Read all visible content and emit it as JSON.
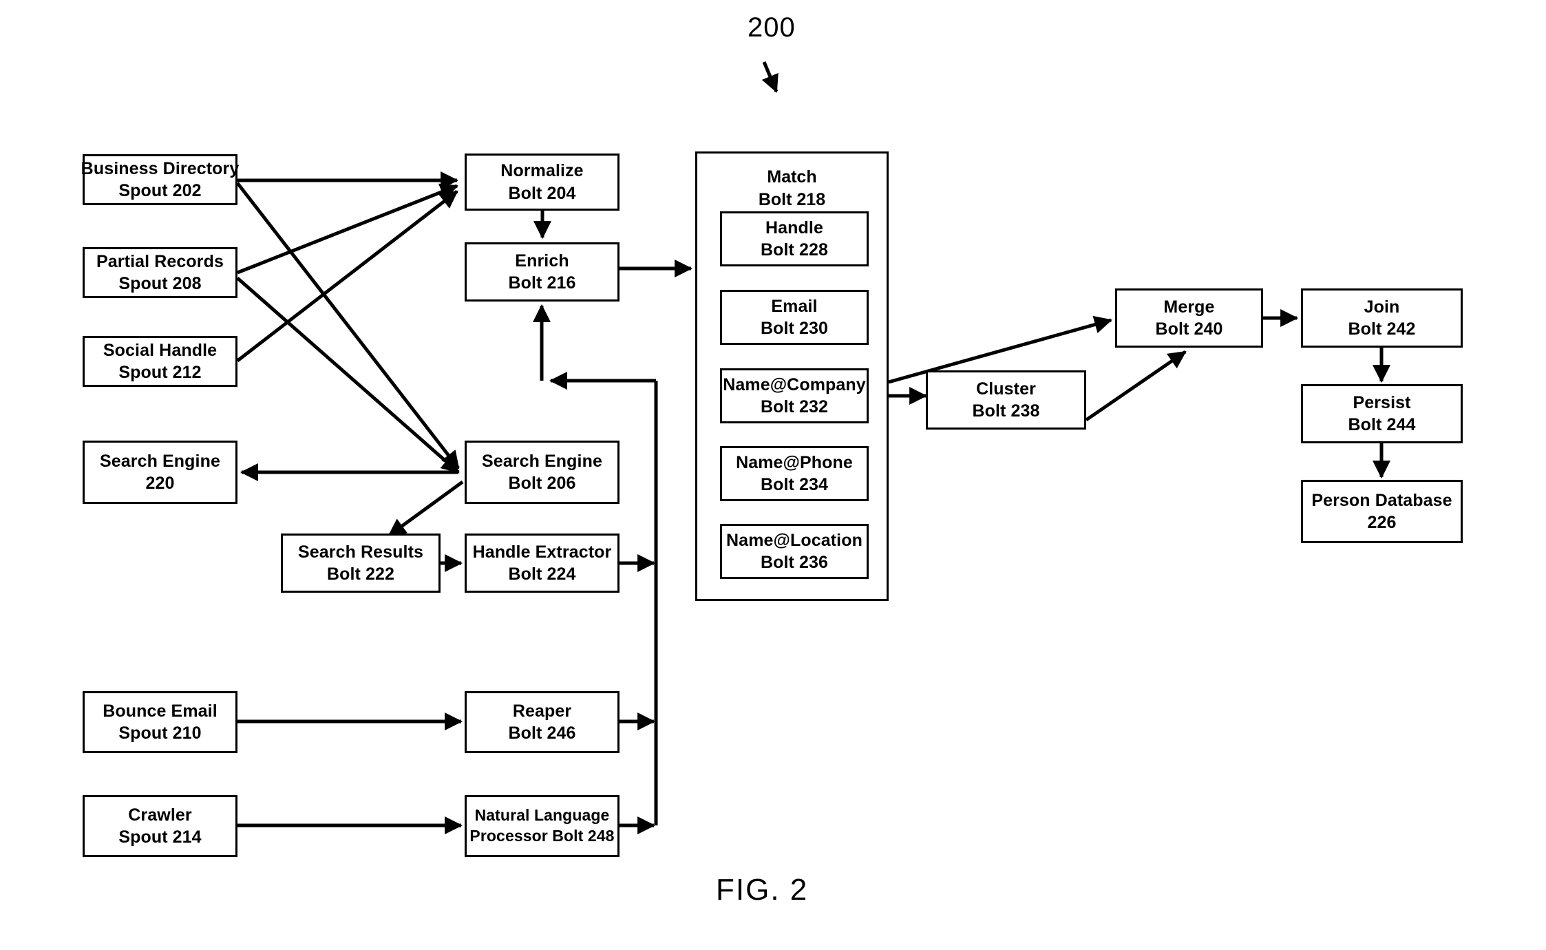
{
  "figure": {
    "reference_numeral": "200",
    "caption": "FIG. 2",
    "line_color": "#000000",
    "background_color": "#ffffff"
  },
  "nodes": {
    "business_directory_spout": {
      "line1": "Business Directory",
      "line2": "Spout 202"
    },
    "partial_records_spout": {
      "line1": "Partial Records",
      "line2": "Spout 208"
    },
    "social_handle_spout": {
      "line1": "Social Handle",
      "line2": "Spout 212"
    },
    "search_engine_external": {
      "line1": "Search Engine",
      "line2": "220"
    },
    "bounce_email_spout": {
      "line1": "Bounce Email",
      "line2": "Spout 210"
    },
    "crawler_spout": {
      "line1": "Crawler",
      "line2": "Spout 214"
    },
    "normalize_bolt": {
      "line1": "Normalize",
      "line2": "Bolt 204"
    },
    "enrich_bolt": {
      "line1": "Enrich",
      "line2": "Bolt 216"
    },
    "search_engine_bolt": {
      "line1": "Search Engine",
      "line2": "Bolt 206"
    },
    "search_results_bolt": {
      "line1": "Search Results",
      "line2": "Bolt 222"
    },
    "handle_extractor_bolt": {
      "line1": "Handle Extractor",
      "line2": "Bolt 224"
    },
    "reaper_bolt": {
      "line1": "Reaper",
      "line2": "Bolt 246"
    },
    "nlp_bolt": {
      "line1": "Natural Language",
      "line2": "Processor Bolt 248"
    },
    "match_bolt": {
      "line1": "Match",
      "line2": "Bolt 218"
    },
    "handle_bolt": {
      "line1": "Handle",
      "line2": "Bolt 228"
    },
    "email_bolt": {
      "line1": "Email",
      "line2": "Bolt 230"
    },
    "name_company_bolt": {
      "line1": "Name@Company",
      "line2": "Bolt 232"
    },
    "name_phone_bolt": {
      "line1": "Name@Phone",
      "line2": "Bolt 234"
    },
    "name_location_bolt": {
      "line1": "Name@Location",
      "line2": "Bolt 236"
    },
    "cluster_bolt": {
      "line1": "Cluster",
      "line2": "Bolt 238"
    },
    "merge_bolt": {
      "line1": "Merge",
      "line2": "Bolt 240"
    },
    "join_bolt": {
      "line1": "Join",
      "line2": "Bolt 242"
    },
    "persist_bolt": {
      "line1": "Persist",
      "line2": "Bolt 244"
    },
    "person_database": {
      "line1": "Person Database",
      "line2": "226"
    }
  },
  "edges": [
    {
      "from": "business_directory_spout",
      "to": "normalize_bolt"
    },
    {
      "from": "business_directory_spout",
      "to": "search_engine_bolt"
    },
    {
      "from": "partial_records_spout",
      "to": "normalize_bolt"
    },
    {
      "from": "partial_records_spout",
      "to": "search_engine_bolt"
    },
    {
      "from": "social_handle_spout",
      "to": "normalize_bolt"
    },
    {
      "from": "normalize_bolt",
      "to": "enrich_bolt"
    },
    {
      "from": "enrich_bolt",
      "to": "match_bolt"
    },
    {
      "from": "search_engine_bolt",
      "to": "search_engine_external"
    },
    {
      "from": "search_engine_bolt",
      "to": "search_results_bolt"
    },
    {
      "from": "search_results_bolt",
      "to": "handle_extractor_bolt"
    },
    {
      "from": "handle_extractor_bolt",
      "to": "enrich_bolt"
    },
    {
      "from": "bounce_email_spout",
      "to": "reaper_bolt"
    },
    {
      "from": "reaper_bolt",
      "to": "enrich_bolt"
    },
    {
      "from": "crawler_spout",
      "to": "nlp_bolt"
    },
    {
      "from": "nlp_bolt",
      "to": "enrich_bolt"
    },
    {
      "from": "match_bolt",
      "to": "cluster_bolt"
    },
    {
      "from": "match_bolt",
      "to": "merge_bolt"
    },
    {
      "from": "cluster_bolt",
      "to": "merge_bolt"
    },
    {
      "from": "merge_bolt",
      "to": "join_bolt"
    },
    {
      "from": "join_bolt",
      "to": "persist_bolt"
    },
    {
      "from": "persist_bolt",
      "to": "person_database"
    }
  ]
}
